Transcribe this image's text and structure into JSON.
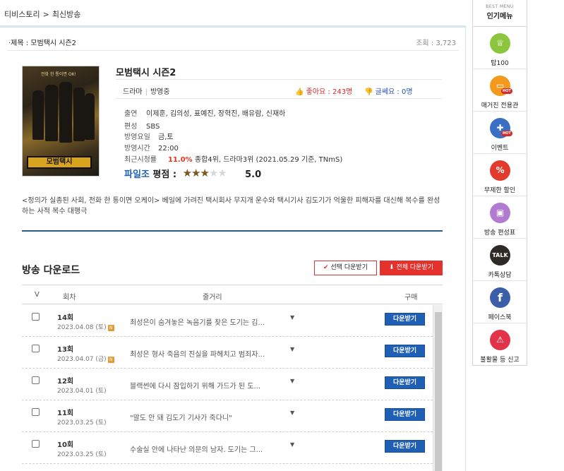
{
  "breadcrumb": {
    "home": "티비스토리",
    "sep": ">",
    "current": "최신방송"
  },
  "title_bar": {
    "label": "·제목 : 모범택시 시즌2",
    "views": "조회 : 3,723"
  },
  "poster": {
    "tagline": "전화 한 통이면 OK!",
    "logo": "모범택시"
  },
  "show": {
    "title": "모범택시 시즌2",
    "genre": "드라마",
    "status": "방영중",
    "likes": "좋아요 : 243명",
    "dislikes": "글쎄요 : 0명"
  },
  "meta": {
    "cast_k": "출연",
    "cast_v": "이제훈, 김의성, 표예진, 장혁진, 배유람, 신재하",
    "network_k": "편성",
    "network_v": "SBS",
    "day_k": "방영요일",
    "day_v": "금,토",
    "time_k": "방영시간",
    "time_v": "22:00",
    "rating_k": "최근시청률",
    "rating_pct": "11.0%",
    "rating_v": " 종합4위, 드라마3위 (2021.05.29 기준, TNmS)"
  },
  "rating": {
    "brand": "파일조",
    "label": "평점 :",
    "score": "5.0",
    "stars_filled_fraction": 0.5,
    "star_color": "#7a5a1f"
  },
  "synopsis": "<정의가 실종된 사회, 전화 한 통이면 오케이> 베일에 가려진 택시회사 무지개 운수와 택시기사 김도기가 억울한 피해자를 대신해 복수를 완성하는 사적 복수 대행극",
  "download": {
    "heading": "방송 다운로드",
    "select_btn": "선택 다운받기",
    "all_btn": "전체 다운받기",
    "columns": {
      "check": "V",
      "episode": "회차",
      "plot": "줄거리",
      "buy": "구매"
    },
    "rows": [
      {
        "ep": "14회",
        "date": "2023.04.08 (토)",
        "new": "N",
        "plot": "최성은이 숨겨놓은 녹음기를 찾은 도기는 김...",
        "btn": "다운받기"
      },
      {
        "ep": "13회",
        "date": "2023.04.07 (금)",
        "new": "N",
        "plot": "최성은 형사 죽음의 진실을 파헤치고 범죄자...",
        "btn": "다운받기"
      },
      {
        "ep": "12회",
        "date": "2023.04.01 (토)",
        "new": "",
        "plot": "블랙썬에 다시 잠입하기 위해 가드가 된 도...",
        "btn": "다운받기"
      },
      {
        "ep": "11회",
        "date": "2023.03.25 (토)",
        "new": "",
        "plot": "\"말도 안 돼 김도기 기사가 죽다니\"",
        "btn": "다운받기"
      },
      {
        "ep": "10회",
        "date": "2023.03.25 (토)",
        "new": "",
        "plot": "수술실 안에 나타난 의문의 남자. 도기는 그...",
        "btn": "다운받기"
      }
    ]
  },
  "sidebar": {
    "small": "BEST MENU",
    "title": "인기메뉴",
    "hot": "HOT",
    "items": [
      {
        "label": "탑100",
        "glyph": "♕",
        "color": "#8cc63f",
        "hot": false
      },
      {
        "label": "매거진 전용관",
        "glyph": "▭",
        "color": "#f39a1e",
        "hot": true
      },
      {
        "label": "이벤트",
        "glyph": "✚",
        "color": "#3a6fc4",
        "hot": true
      },
      {
        "label": "무제한 할인",
        "glyph": "%",
        "color": "#e23b2e",
        "hot": false
      },
      {
        "label": "방송 편성표",
        "glyph": "▣",
        "color": "#b17bd1",
        "hot": false
      },
      {
        "label": "카톡상담",
        "glyph": "TALK",
        "color": "#2e2a26",
        "hot": false
      },
      {
        "label": "페이스북",
        "glyph": "f",
        "color": "#3b5ea8",
        "hot": false
      },
      {
        "label": "불활물 등 신고",
        "glyph": "⚠",
        "color": "#e2334a",
        "hot": false
      }
    ]
  }
}
